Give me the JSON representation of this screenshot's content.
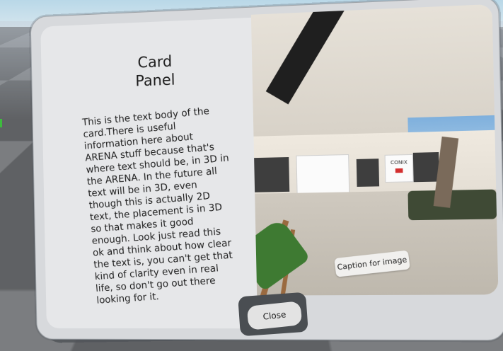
{
  "scene": {
    "floor_colors": {
      "light": "#7b7d80",
      "dark": "#5f6164"
    },
    "sky_color": "#cfe3ee"
  },
  "card": {
    "title_line1": "Card",
    "title_line2": "Panel",
    "body": "This is the text body of the card.There is useful information here about ARENA stuff because that's where text should be, in 3D in the ARENA. In the future all text will be in 3D, even though this is actually 2D text, the placement is in 3D so that makes it good enough. Look just read this ok and think about how clear the text is, you can't get that kind of clarity even in real life, so don't go out there looking for it.",
    "image_caption": "Caption for image",
    "close_label": "Close"
  },
  "image_scene": {
    "screen_brand": "CONIX",
    "accent_red": "#d32f2f",
    "chair_color": "#3e7a32"
  }
}
